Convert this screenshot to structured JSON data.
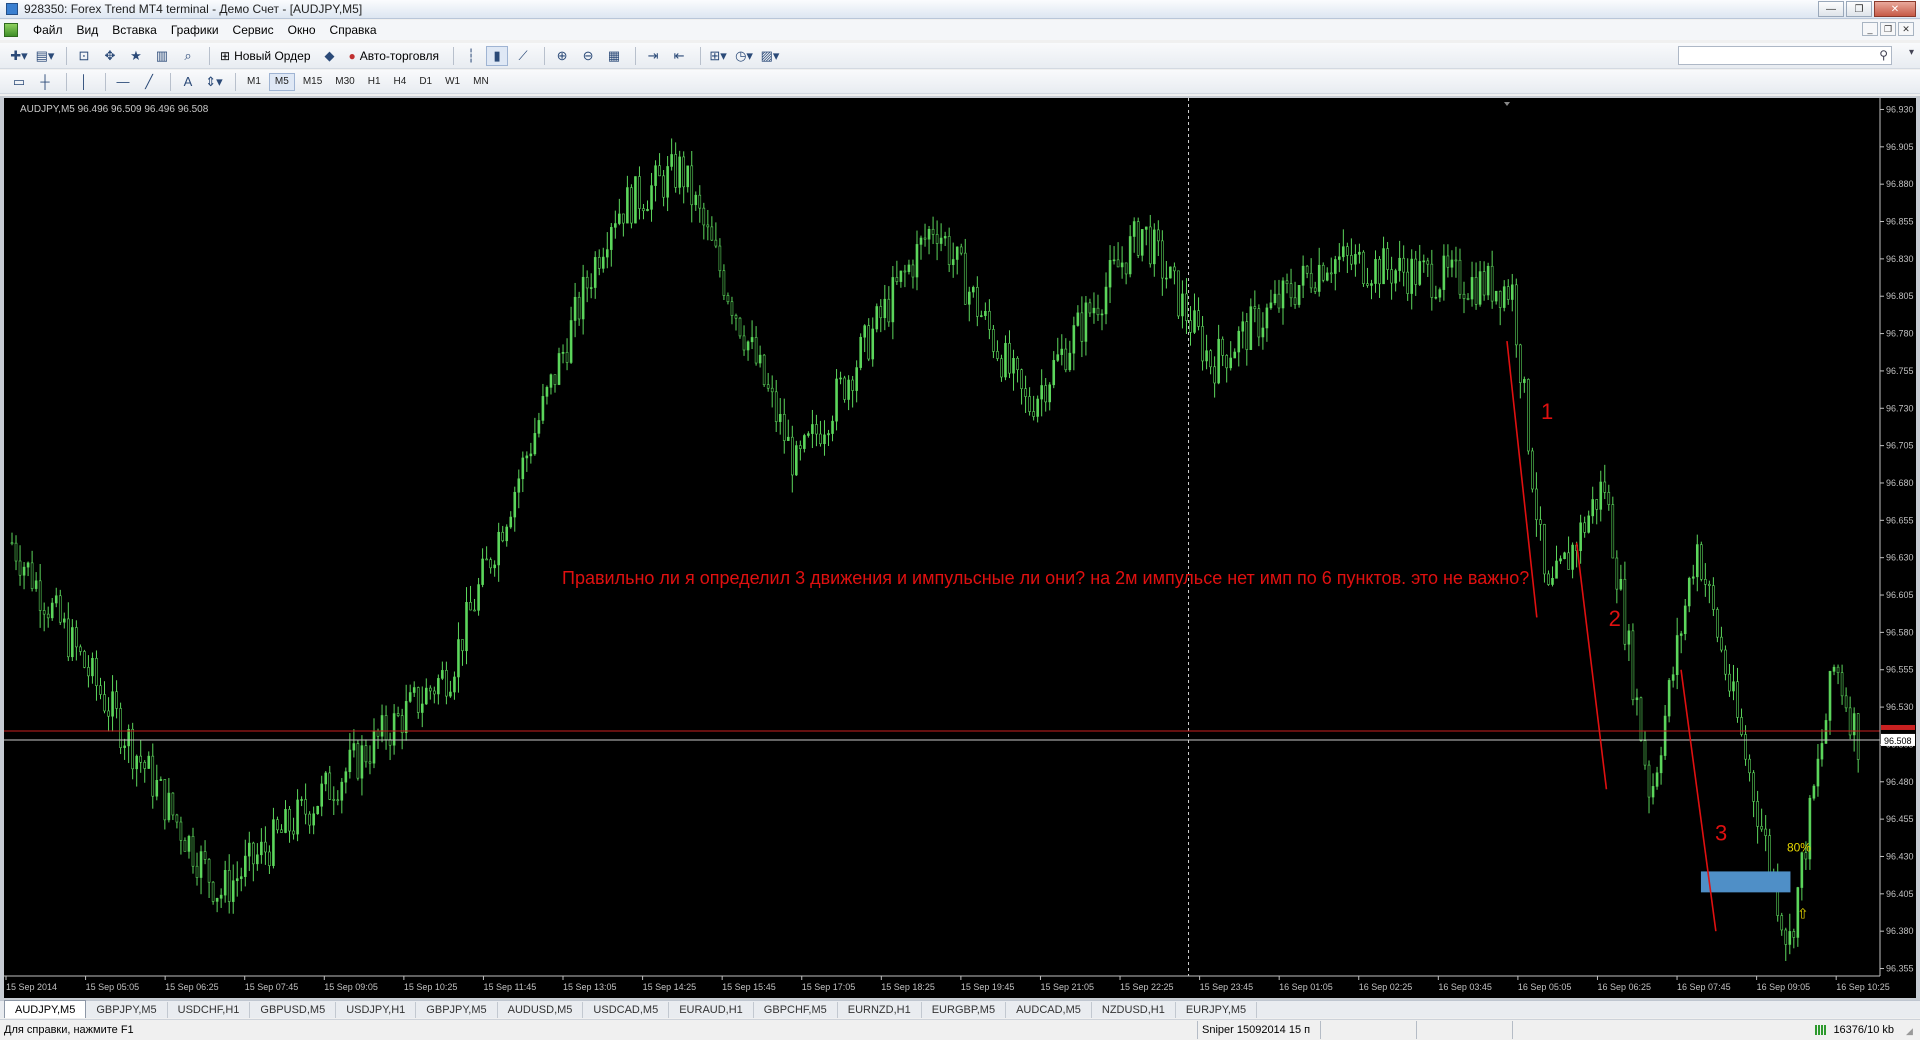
{
  "window": {
    "title": "928350: Forex Trend MT4 terminal - Демо Счет - [AUDJPY,M5]",
    "buttons": [
      "—",
      "❐",
      "✕"
    ]
  },
  "menu": {
    "items": [
      "Файл",
      "Вид",
      "Вставка",
      "Графики",
      "Сервис",
      "Окно",
      "Справка"
    ],
    "mdi_buttons": [
      "_",
      "❐",
      "✕"
    ]
  },
  "toolbar": {
    "new_order_label": "Новый Ордер",
    "auto_trading_label": "Авто-торговля",
    "search_placeholder": ""
  },
  "timeframes": {
    "items": [
      "M1",
      "M5",
      "M15",
      "M30",
      "H1",
      "H4",
      "D1",
      "W1",
      "MN"
    ],
    "active": "M5"
  },
  "chart": {
    "header": "AUDJPY,M5  96.496 96.509 96.496 96.508",
    "annotation": "Правильно ли я определил 3 движения и импульсные ли они? на 2м  импульсе нет имп по 6 пунктов. это не важно?",
    "wave_labels": [
      "1",
      "2",
      "3"
    ],
    "percent_label": "80%",
    "arrow_glyph": "⇧",
    "bid_price": "96.508",
    "colors": {
      "background": "#000000",
      "candles": "#5cd65c",
      "wave_lines": "#e01010",
      "annotation": "#e01010",
      "zone": "#4f8fc7",
      "percent_label": "#e8d800",
      "price_line": "#c8c8c8",
      "ask_line": "#c82020",
      "axis_text": "#c0c0c0"
    }
  },
  "chart_data": {
    "type": "candlestick",
    "symbol": "AUDJPY",
    "timeframe": "M5",
    "ylim": [
      96.35,
      96.935
    ],
    "yticks": [
      96.93,
      96.905,
      96.88,
      96.855,
      96.83,
      96.805,
      96.78,
      96.755,
      96.73,
      96.705,
      96.68,
      96.655,
      96.63,
      96.605,
      96.58,
      96.555,
      96.53,
      96.505,
      96.48,
      96.455,
      96.43,
      96.405,
      96.38,
      96.355
    ],
    "ytick_labels": [
      "96.930",
      "96.905",
      "96.880",
      "96.855",
      "96.830",
      "96.805",
      "96.780",
      "96.755",
      "96.730",
      "96.705",
      "96.680",
      "96.655",
      "96.630",
      "96.605",
      "96.580",
      "96.555",
      "96.530",
      "96.505",
      "96.480",
      "96.455",
      "96.430",
      "96.405",
      "96.380",
      "96.355"
    ],
    "xtick_labels": [
      "15 Sep 2014",
      "15 Sep 05:05",
      "15 Sep 06:25",
      "15 Sep 07:45",
      "15 Sep 09:05",
      "15 Sep 10:25",
      "15 Sep 11:45",
      "15 Sep 13:05",
      "15 Sep 14:25",
      "15 Sep 15:45",
      "15 Sep 17:05",
      "15 Sep 18:25",
      "15 Sep 19:45",
      "15 Sep 21:05",
      "15 Sep 22:25",
      "15 Sep 23:45",
      "16 Sep 01:05",
      "16 Sep 02:25",
      "16 Sep 03:45",
      "16 Sep 05:05",
      "16 Sep 06:25",
      "16 Sep 07:45",
      "16 Sep 09:05",
      "16 Sep 10:25"
    ],
    "last": {
      "open": 96.496,
      "high": 96.509,
      "low": 96.496,
      "close": 96.508
    },
    "bid_line": 96.508,
    "ask_line": 96.514,
    "close_profile": [
      96.64,
      96.61,
      96.63,
      96.57,
      96.49,
      96.45,
      96.43,
      96.46,
      96.42,
      96.48,
      96.52,
      96.5,
      96.49,
      96.51,
      96.52,
      96.5,
      96.67,
      96.65,
      96.62,
      96.7,
      96.73,
      96.75,
      96.72,
      96.74,
      96.71,
      96.77,
      96.79,
      96.81,
      96.85,
      96.79,
      96.77,
      96.82,
      96.83,
      96.79,
      96.77,
      96.72,
      96.7,
      96.74,
      96.77,
      96.79,
      96.83,
      96.85,
      96.82,
      96.78,
      96.77,
      96.76,
      96.74,
      96.75,
      96.78,
      96.81,
      96.82,
      96.79,
      96.77,
      96.77,
      96.78,
      96.8,
      96.78,
      96.76,
      96.75,
      96.77,
      96.76,
      96.79,
      96.8,
      96.81,
      96.79,
      96.78,
      96.77,
      96.79,
      96.8,
      96.78,
      96.76,
      96.79,
      96.8,
      96.77,
      96.72,
      96.63,
      96.6,
      96.64,
      96.62,
      96.64,
      96.66,
      96.6,
      96.55,
      96.52,
      96.47,
      96.5,
      96.53,
      96.55,
      96.6,
      96.59,
      96.56,
      96.53,
      96.51,
      96.5,
      96.48,
      96.45,
      96.42,
      96.44,
      96.4,
      96.46,
      96.52,
      96.55,
      96.51
    ],
    "swing_lows_highs": [
      {
        "x": 0.0,
        "y": 96.64
      },
      {
        "x": 0.09,
        "y": 96.405
      },
      {
        "x": 0.19,
        "y": 96.555
      },
      {
        "x": 0.26,
        "y": 96.86
      },
      {
        "x": 0.29,
        "y": 96.89
      },
      {
        "x": 0.34,
        "y": 96.69
      },
      {
        "x": 0.4,
        "y": 96.855
      },
      {
        "x": 0.44,
        "y": 96.73
      },
      {
        "x": 0.49,
        "y": 96.85
      },
      {
        "x": 0.52,
        "y": 96.76
      },
      {
        "x": 0.57,
        "y": 96.83
      },
      {
        "x": 0.65,
        "y": 96.81
      },
      {
        "x": 0.665,
        "y": 96.6
      },
      {
        "x": 0.69,
        "y": 96.68
      },
      {
        "x": 0.71,
        "y": 96.47
      },
      {
        "x": 0.73,
        "y": 96.64
      },
      {
        "x": 0.77,
        "y": 96.37
      },
      {
        "x": 0.79,
        "y": 96.56
      },
      {
        "x": 0.8,
        "y": 96.508
      }
    ],
    "wave_lines": [
      {
        "label": "1",
        "from": {
          "t": "16 Sep 04:50",
          "price": 96.775
        },
        "to": {
          "t": "16 Sep 05:20",
          "price": 96.59
        }
      },
      {
        "label": "2",
        "from": {
          "t": "16 Sep 06:00",
          "price": 96.64
        },
        "to": {
          "t": "16 Sep 06:30",
          "price": 96.475
        }
      },
      {
        "label": "3",
        "from": {
          "t": "16 Sep 07:45",
          "price": 96.555
        },
        "to": {
          "t": "16 Sep 08:20",
          "price": 96.38
        }
      }
    ],
    "zone": {
      "from": 96.42,
      "to": 96.41,
      "start_t": "16 Sep 08:05",
      "end_t": "16 Sep 09:35"
    },
    "grid": false
  },
  "tabs": {
    "items": [
      "AUDJPY,M5",
      "GBPJPY,M5",
      "USDCHF,H1",
      "GBPUSD,M5",
      "USDJPY,H1",
      "GBPJPY,M5",
      "AUDUSD,M5",
      "USDCAD,M5",
      "EURAUD,H1",
      "GBPCHF,M5",
      "EURNZD,H1",
      "EURGBP,M5",
      "AUDCAD,M5",
      "NZDUSD,H1",
      "EURJPY,M5"
    ],
    "active_index": 0
  },
  "status": {
    "help": "Для справки, нажмите F1",
    "profile": "Sniper 15092014 15 п",
    "traffic": "16376/10 kb"
  }
}
